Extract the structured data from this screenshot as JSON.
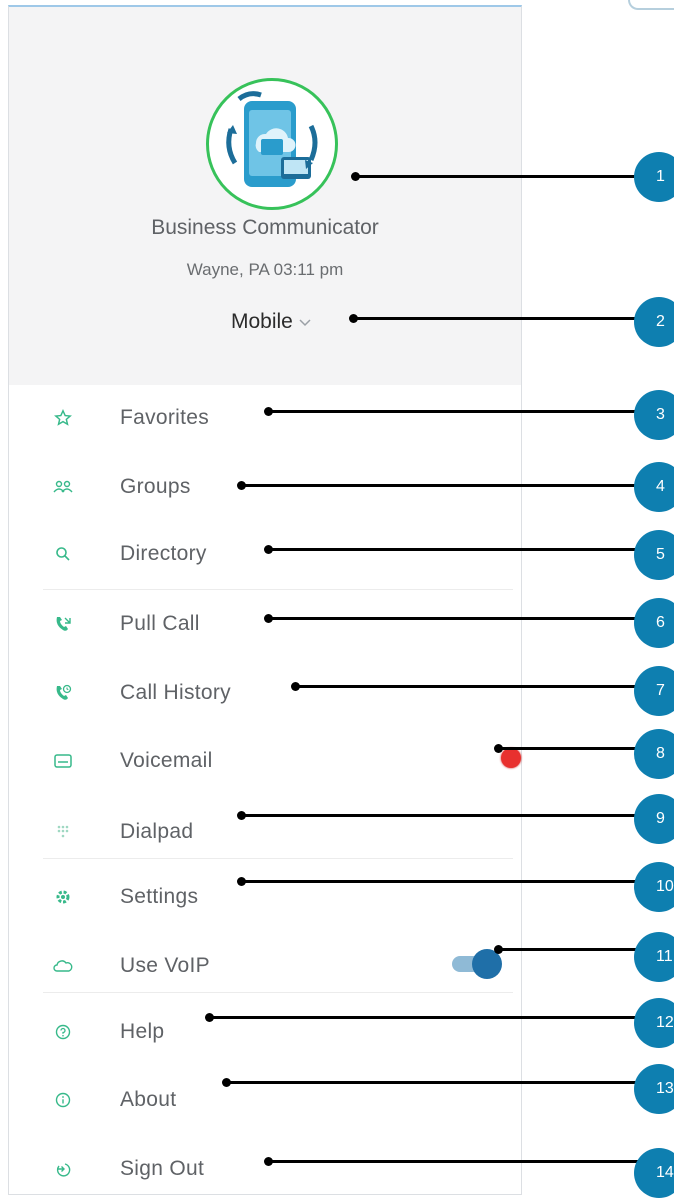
{
  "header": {
    "app_name": "Business Communicator",
    "location_time": "Wayne, PA 03:11 pm",
    "mode_label": "Mobile"
  },
  "menu": {
    "items": [
      {
        "label": "Favorites",
        "icon": "star-icon"
      },
      {
        "label": "Groups",
        "icon": "groups-icon"
      },
      {
        "label": "Directory",
        "icon": "search-icon"
      },
      {
        "label": "Pull Call",
        "icon": "pull-call-icon"
      },
      {
        "label": "Call History",
        "icon": "call-history-icon"
      },
      {
        "label": "Voicemail",
        "icon": "voicemail-icon"
      },
      {
        "label": "Dialpad",
        "icon": "dialpad-icon"
      },
      {
        "label": "Settings",
        "icon": "gear-icon"
      },
      {
        "label": "Use VoIP",
        "icon": "cloud-icon"
      },
      {
        "label": "Help",
        "icon": "help-icon"
      },
      {
        "label": "About",
        "icon": "info-icon"
      },
      {
        "label": "Sign Out",
        "icon": "sign-out-icon"
      }
    ]
  },
  "voicemail_badge": {
    "label": "!",
    "color": "#e8302e"
  },
  "voip_toggle": {
    "on": true
  },
  "callouts": [
    "1",
    "2",
    "3",
    "4",
    "5",
    "6",
    "7",
    "8",
    "9",
    "10",
    "11",
    "12",
    "13",
    "14"
  ],
  "colors": {
    "accent": "#37b98a",
    "callout": "#0e7fb0",
    "header_bg": "#f4f4f5"
  }
}
